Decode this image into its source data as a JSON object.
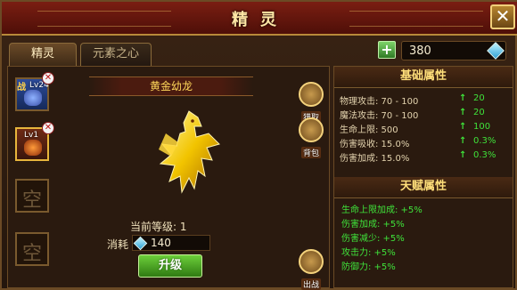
{
  "window": {
    "title": "精灵",
    "close_glyph": "✕"
  },
  "tabs": [
    {
      "label": "精灵",
      "active": true
    },
    {
      "label": "元素之心",
      "active": false
    }
  ],
  "currency": {
    "plus_glyph": "+",
    "value": "380",
    "icon": "gem-icon"
  },
  "slots": [
    {
      "tag": "战",
      "level": "Lv24",
      "filled": true
    },
    {
      "level": "Lv1",
      "filled": true,
      "selected": true
    },
    {
      "empty_text": "空",
      "filled": false
    },
    {
      "empty_text": "空",
      "filled": false
    }
  ],
  "pet": {
    "name": "黄金幼龙",
    "level_text": "当前等级: 1",
    "cost_label": "消耗",
    "cost_value": "140",
    "upgrade_label": "升级"
  },
  "side_buttons": {
    "hunt": "猎取",
    "bag": "背包",
    "battle": "出战"
  },
  "base_attributes": {
    "title": "基础属性",
    "rows": [
      {
        "name": "物理攻击: 70 - 100",
        "inc": "20"
      },
      {
        "name": "魔法攻击: 70 - 100",
        "inc": "20"
      },
      {
        "name": "生命上限: 500",
        "inc": "100"
      },
      {
        "name": "伤害吸收: 15.0%",
        "inc": "0.3%"
      },
      {
        "name": "伤害加成: 15.0%",
        "inc": "0.3%"
      }
    ],
    "arrow_glyph": "↑"
  },
  "talent_attributes": {
    "title": "天赋属性",
    "rows": [
      "生命上限加成: +5%",
      "伤害加成: +5%",
      "伤害减少: +5%",
      "攻击力: +5%",
      "防御力: +5%"
    ]
  }
}
